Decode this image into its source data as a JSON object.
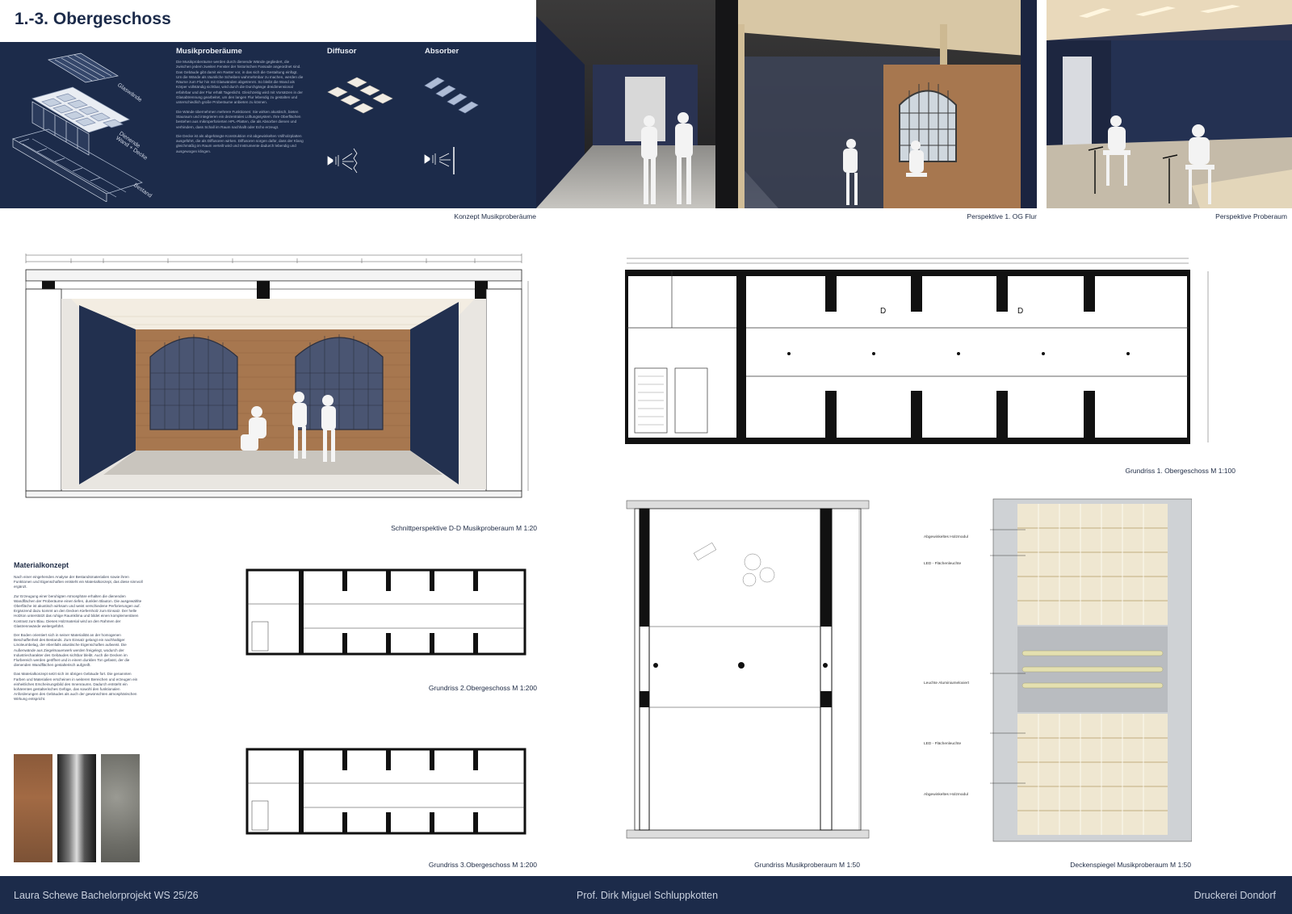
{
  "header": {
    "title": "1.-3. Obergeschoss"
  },
  "concept": {
    "heading_main": "Musikproberäume",
    "heading_diffusor": "Diffusor",
    "heading_absorber": "Absorber",
    "iso_labels": [
      "Glaswände",
      "Dienende Wand + Decke",
      "Bestand"
    ],
    "text_paragraphs": [
      "Die Musikproberäume werden durch dienende Wände gegliedert, die zwischen jedem zweiten Fenster der historischen Fassade angeordnet sind. Das Gebäude gibt damit ein Raster vor, in das sich die Gestaltung einfügt. Um die Wände als räumliche Scheiben wahrnehmbar zu machen, werden die Räume zum Flur hin mit Glaswänden abgetrennt. So bleibt die Wand als Körper vollständig sichtbar, wird durch die Durchgänge dreidimensional erfahrbar und der Flur erhält Tageslicht. Gleichzeitig wird mit Vorsätzen in der Glasabtrennung gearbeitet, um den langen Flur lebendig zu gestalten und unterschiedlich große Proberäume anbieten zu können.",
      "Die Wände übernehmen mehrere Funktionen: Sie wirken akustisch, bieten Stauraum und integrieren ein dezentrales Lüftungssystem. Ihre Oberflächen bestehen aus mikroperforierten HPL-Platten, die als Absorber dienen und verhindern, dass Schall im Raum nachhallt oder Echo erzeugt.",
      "Die Decke ist als abgehängte Konstruktion mit abgewinkelten Vollholzplatten ausgeführt, die als Diffusoren wirken. Diffusoren sorgen dafür, dass der Klang gleichmäßig im Raum verteilt wird und Instrumente dadurch lebendig und ausgewogen klingen."
    ],
    "caption": "Konzept Musikproberäume"
  },
  "renders": {
    "corridor_caption": "Perspektive 1. OG Flur",
    "rehearsal_caption": "Perspektive Proberaum"
  },
  "section": {
    "caption": "Schnittperspektive D-D Musikproberaum M 1:20"
  },
  "plans": {
    "og1_caption": "Grundriss 1. Obergeschoss M 1:100",
    "og2_caption": "Grundriss 2.Obergeschoss M 1:200",
    "og3_caption": "Grundriss 3.Obergeschoss M 1:200",
    "room_caption": "Grundriss Musikproberaum M 1:50",
    "ceiling_caption": "Deckenspiegel Musikproberaum M 1:50",
    "section_markers": [
      "D",
      "D"
    ]
  },
  "ceiling_labels": [
    "Abgewinkeltes Holzmodul",
    "LED - Flächenleuchte",
    "Leuchte Aluminiumeloxiert",
    "LED - Flächenleuchte",
    "Abgewinkeltes Holzmodul"
  ],
  "material": {
    "heading": "Materialkonzept",
    "paragraphs": [
      "Nach einer eingehenden Analyse der Bestandsmaterialien sowie ihren Funktionen und Eigenschaften entsteht ein Materialkonzept, das diese sinnvoll ergänzt.",
      "Zur Erzeugung einer beruhigten Atmosphäre erhalten die dienenden Wandflächen der Proberäume einen tiefen, dunklen Blauton. Die ausgewählte Oberfläche ist akustisch wirksam und weist verschiedene Perforierungen auf. Ergänzend dazu kommt an den Decken Kiefernholz zum Einsatz. Der helle Holzton unterstützt das ruhige Raumklima und bildet einen komplementären Kontrast zum Blau. Dieses Holzmaterial wird an den Rahmen der Glastrennwände weitergeführt.",
      "Der Boden orientiert sich in seiner Materialität an der homogenen Beschaffenheit des Bestands. Zum Einsatz gelangt ein nachhaltiger Linoleumbelag, der ebenfalls akustische Eigenschaften aufweist. Die Außenwände aus Ziegelmauerwerk werden freigelegt, wodurch der Industriecharakter des Gebäudes sichtbar bleibt. Auch die Decken im Flurbereich werden geöffnet und in einem dunklen Ton gefasst, der die dienenden Wandflächen gestalterisch aufgreift.",
      "Das Materialkonzept setzt sich im übrigen Gebäude fort. Die genannten Farben und Materialien erscheinen in weiteren Bereichen und erzeugen ein einheitliches Erscheinungsbild des Innenraums. Dadurch entsteht ein kohärentes gestalterisches Gefüge, das sowohl den funktionalen Anforderungen des Gebäudes als auch der gewünschten atmosphärischen Wirkung entspricht."
    ]
  },
  "footer": {
    "left": "Laura Schewe Bachelorprojekt WS 25/26",
    "center": "Prof. Dirk Miguel Schluppkotten",
    "right": "Druckerei Dondorf"
  },
  "colors": {
    "navy": "#1c2b4a",
    "brick": "#a7774f",
    "wood": "#e7d6b8",
    "panel_blue": "#24304d"
  }
}
